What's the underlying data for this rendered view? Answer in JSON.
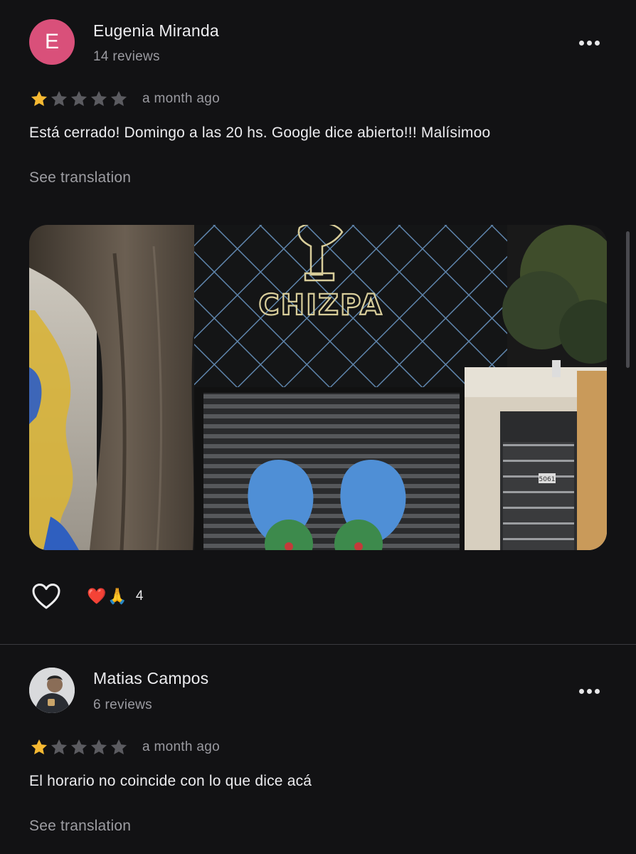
{
  "reviews": [
    {
      "avatar_letter": "E",
      "name": "Eugenia Miranda",
      "review_count": "14 reviews",
      "rating": 1,
      "date": "a month ago",
      "text": "Está cerrado! Domingo a las 20 hs. Google dice abierto!!! Malísimoo",
      "translation_link": "See translation",
      "photo": {
        "sign_text": "CHIZPA",
        "number_plate": "5061"
      },
      "reactions": {
        "emoji": [
          "❤️",
          "🙏"
        ],
        "count": "4"
      }
    },
    {
      "name": "Matias Campos",
      "review_count": "6 reviews",
      "rating": 1,
      "date": "a month ago",
      "text": "El horario no coincide con lo que dice acá",
      "translation_link": "See translation"
    }
  ],
  "colors": {
    "background": "#121214",
    "star_filled": "#f6b932",
    "star_empty": "#5b5b60",
    "avatar_e": "#d9507a"
  },
  "icons": {
    "more": "more-options-icon",
    "like": "heart-outline-icon",
    "star": "star-icon"
  }
}
